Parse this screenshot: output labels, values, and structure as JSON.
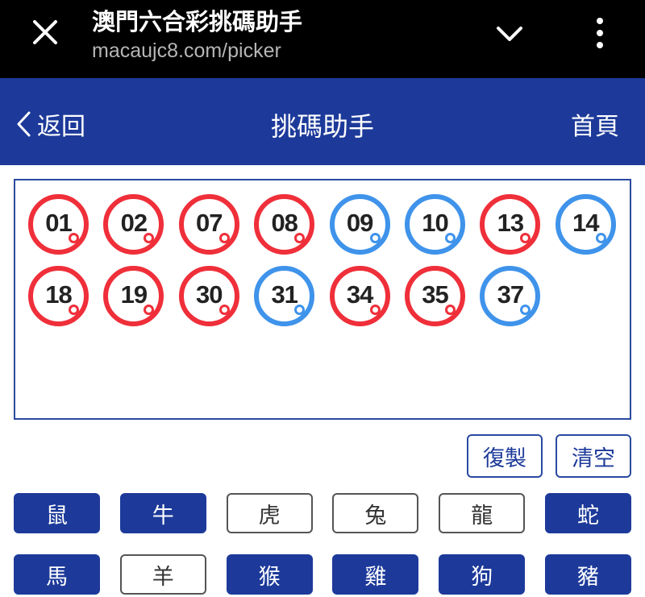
{
  "browser": {
    "title": "澳門六合彩挑碼助手",
    "url": "macaujc8.com/picker",
    "close_icon": "close-icon",
    "expand_icon": "chevron-down-icon",
    "menu_icon": "more-vert-icon"
  },
  "header": {
    "back_label": "返回",
    "title": "挑碼助手",
    "home_label": "首頁",
    "color": "#1d3a9a"
  },
  "selected_numbers": [
    {
      "num": "01",
      "color": "red"
    },
    {
      "num": "02",
      "color": "red"
    },
    {
      "num": "07",
      "color": "red"
    },
    {
      "num": "08",
      "color": "red"
    },
    {
      "num": "09",
      "color": "blue"
    },
    {
      "num": "10",
      "color": "blue"
    },
    {
      "num": "13",
      "color": "red"
    },
    {
      "num": "14",
      "color": "blue"
    },
    {
      "num": "18",
      "color": "red"
    },
    {
      "num": "19",
      "color": "red"
    },
    {
      "num": "30",
      "color": "red"
    },
    {
      "num": "31",
      "color": "blue"
    },
    {
      "num": "34",
      "color": "red"
    },
    {
      "num": "35",
      "color": "red"
    },
    {
      "num": "37",
      "color": "blue"
    }
  ],
  "ball_colors": {
    "red": "#ef2f3a",
    "blue": "#3f93ea"
  },
  "actions": {
    "copy_label": "復製",
    "clear_label": "清空"
  },
  "zodiacs": [
    {
      "label": "鼠",
      "selected": true
    },
    {
      "label": "牛",
      "selected": true
    },
    {
      "label": "虎",
      "selected": false
    },
    {
      "label": "兔",
      "selected": false
    },
    {
      "label": "龍",
      "selected": false
    },
    {
      "label": "蛇",
      "selected": true
    },
    {
      "label": "馬",
      "selected": true
    },
    {
      "label": "羊",
      "selected": false
    },
    {
      "label": "猴",
      "selected": true
    },
    {
      "label": "雞",
      "selected": true
    },
    {
      "label": "狗",
      "selected": true
    },
    {
      "label": "豬",
      "selected": true
    }
  ]
}
